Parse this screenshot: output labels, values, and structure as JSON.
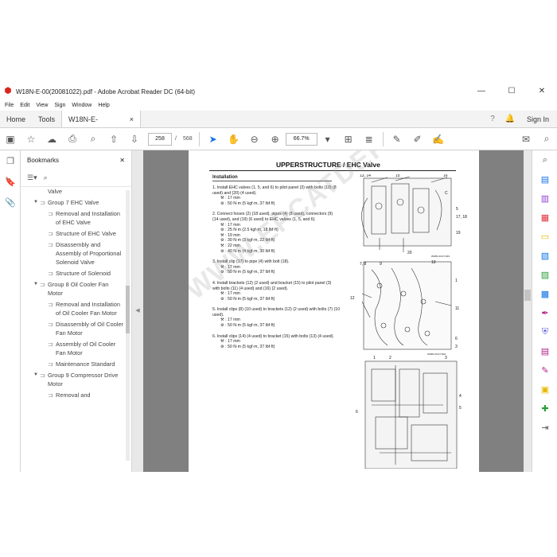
{
  "window": {
    "title": "W18N-E-00(20081022).pdf - Adobe Acrobat Reader DC (64-bit)",
    "app_icon": "acrobat-icon",
    "controls": [
      "minimize-icon",
      "maximize-icon",
      "close-icon"
    ]
  },
  "menu": [
    "File",
    "Edit",
    "View",
    "Sign",
    "Window",
    "Help"
  ],
  "tabs": {
    "home": "Home",
    "tools": "Tools",
    "doc": "W18N-E-00(200810...",
    "doc_close": "×",
    "signin": "Sign In"
  },
  "toolbar": {
    "page_current": "258",
    "page_sep": "/",
    "page_total": "568",
    "zoom": "66.7%"
  },
  "bookmarks": {
    "title": "Bookmarks",
    "close": "✕",
    "items": [
      {
        "level": 2,
        "label": "Valve",
        "caret": ""
      },
      {
        "level": 1,
        "label": "Group 7 EHC Valve",
        "caret": "▼"
      },
      {
        "level": 2,
        "label": "Removal and Installation of EHC Valve",
        "caret": ""
      },
      {
        "level": 2,
        "label": "Structure of EHC Valve",
        "caret": ""
      },
      {
        "level": 2,
        "label": "Disassembly and Assembly of Proportional Solenoid Valve",
        "caret": ""
      },
      {
        "level": 2,
        "label": "Structure of Solenoid",
        "caret": ""
      },
      {
        "level": 1,
        "label": "Group 8 Oil Cooler Fan Motor",
        "caret": "▼"
      },
      {
        "level": 2,
        "label": "Removal and Installation of Oil Cooler Fan Motor",
        "caret": ""
      },
      {
        "level": 2,
        "label": "Disassembly of Oil Cooler Fan Motor",
        "caret": ""
      },
      {
        "level": 2,
        "label": "Assembly of Oil Cooler Fan Motor",
        "caret": ""
      },
      {
        "level": 2,
        "label": "Maintenance Standard",
        "caret": ""
      },
      {
        "level": 1,
        "label": "Group 9 Compressor Drive Motor",
        "caret": "▼"
      },
      {
        "level": 2,
        "label": "Removal and",
        "caret": ""
      }
    ]
  },
  "page": {
    "title": "UPPERSTRUCTURE / EHC Valve",
    "section": "Installation",
    "steps": [
      {
        "text": "1. Install EHC valves (1, 5, and 6) to pilot panel (3) with bolts (10) (8 used) and (20) (4 used).",
        "specs": [
          ": 17 mm",
          ": 50 N·m (5 kgf·m, 37 lbf·ft)"
        ]
      },
      {
        "text": "2. Connect hoses (2) (18 used), pipes (4) (8 used), connectors (9) (14 used), and (19) (6 used) to EHC valves (1, 5, and 6).",
        "specs": [
          ": 17 mm",
          ": 25 N·m (2.5 kgf·m, 18 lbf·ft)",
          ": 19 mm",
          ": 30 N·m (3 kgf·m, 22 lbf·ft)",
          ": 22 mm",
          ": 40 N·m (4 kgf·m, 30 lbf·ft)"
        ]
      },
      {
        "text": "3. Install clip (17) to pipe (4) with bolt (18).",
        "specs": [
          ": 17 mm",
          ": 50 N·m (5 kgf·m, 37 lbf·ft)"
        ]
      },
      {
        "text": "4. Install brackets (12) (2 used) and bracket (15) to pilot panel (3) with bolts (11) (4 used) and (16) (2 used).",
        "specs": [
          ": 17 mm",
          ": 50 N·m (5 kgf·m, 37 lbf·ft)"
        ]
      },
      {
        "text": "5. Install clips (8) (10 used) to brackets (12) (2 used) with bolts (7) (10 used).",
        "specs": [
          ": 17 mm",
          ": 50 N·m (5 kgf·m, 37 lbf·ft)"
        ]
      },
      {
        "text": "6. Install clips (14) (4 used) to bracket (15) with bolts (13) (4 used).",
        "specs": [
          ": 17 mm",
          ": 50 N·m (5 kgf·m, 37 lbf·ft)"
        ]
      }
    ],
    "fig_labels": {
      "f1": [
        "13, 14",
        "15",
        "16",
        "5",
        "17, 18",
        "19",
        "20",
        "C"
      ],
      "f1_code": "W18N-03-07-003",
      "f2": [
        "7, 8",
        "9",
        "10",
        "12",
        "1",
        "11",
        "6",
        "3"
      ],
      "f2_code": "W18N-03-07-002",
      "f3": [
        "1",
        "2",
        "3",
        "4",
        "5",
        "6"
      ]
    },
    "watermark": "WWW.EPCATDEPO.COM"
  },
  "colors": {
    "accent": "#1473e6",
    "doc_bg": "#808080",
    "panel_bg": "#f0f0f0"
  }
}
